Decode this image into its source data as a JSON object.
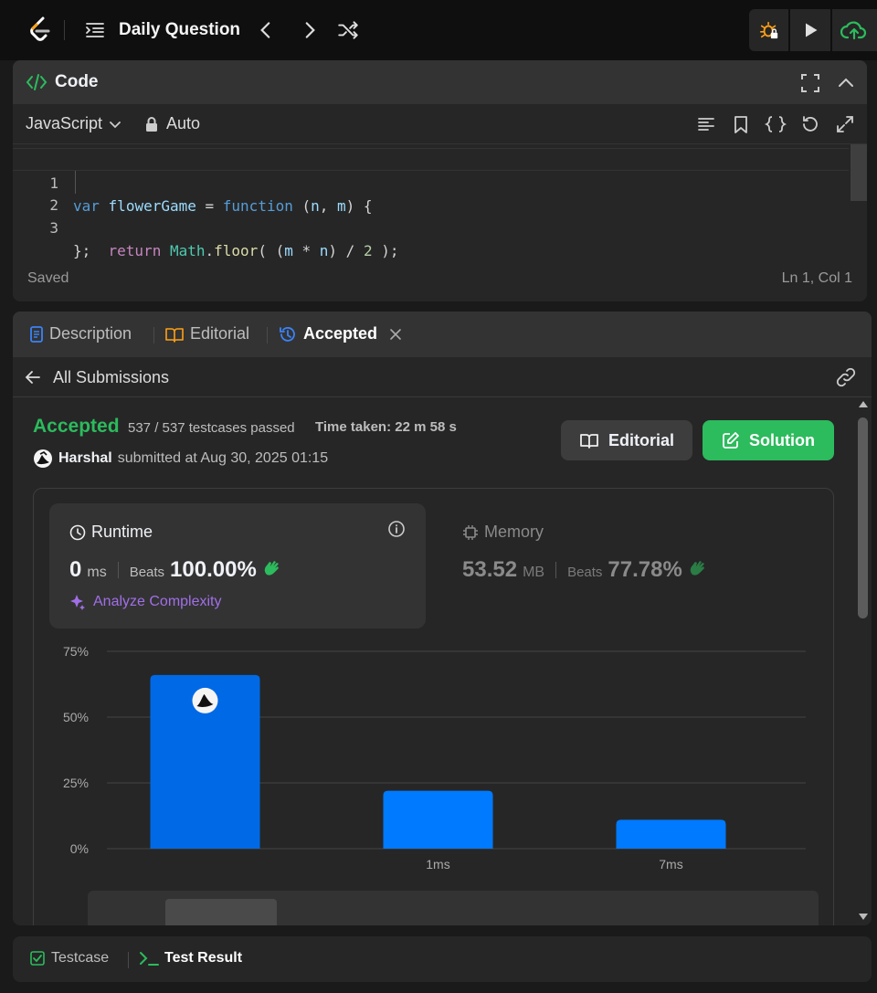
{
  "topbar": {
    "title": "Daily Question",
    "colors": {
      "logo_orange": "#ffa116",
      "debug_orange": "#ffa116",
      "upload_green": "#2cbb5d"
    },
    "icons": [
      "leetcode-logo",
      "list-icon",
      "chevron-left-icon",
      "chevron-right-icon",
      "shuffle-icon",
      "debug-icon",
      "play-icon",
      "cloud-upload-icon"
    ]
  },
  "code_panel": {
    "title": "Code",
    "language": "JavaScript",
    "mode": "Auto",
    "lines": [
      {
        "num": "1",
        "tokens": [
          [
            "kw",
            "var"
          ],
          [
            "pl",
            " "
          ],
          [
            "id",
            "flowerGame"
          ],
          [
            "pl",
            " = "
          ],
          [
            "kw",
            "function"
          ],
          [
            "pl",
            " ("
          ],
          [
            "id",
            "n"
          ],
          [
            "pl",
            ", "
          ],
          [
            "id",
            "m"
          ],
          [
            "pl",
            ") {"
          ]
        ]
      },
      {
        "num": "2",
        "tokens": [
          [
            "pl",
            "    "
          ],
          [
            "kw2",
            "return"
          ],
          [
            "pl",
            " "
          ],
          [
            "cls",
            "Math"
          ],
          [
            "pl",
            "."
          ],
          [
            "fn",
            "floor"
          ],
          [
            "pl",
            "( ("
          ],
          [
            "id",
            "m"
          ],
          [
            "pl",
            " * "
          ],
          [
            "id",
            "n"
          ],
          [
            "pl",
            ") / "
          ],
          [
            "num",
            "2"
          ],
          [
            "pl",
            " );"
          ]
        ]
      },
      {
        "num": "3",
        "tokens": [
          [
            "pl",
            "};"
          ]
        ]
      }
    ],
    "status_left": "Saved",
    "status_right": "Ln 1, Col 1"
  },
  "tabs": {
    "description": "Description",
    "editorial": "Editorial",
    "accepted": "Accepted"
  },
  "submissions": {
    "back_label": "All Submissions",
    "status": "Accepted",
    "testcases": "537 / 537 testcases passed",
    "time_taken": "Time taken: 22 m 58 s",
    "user": "Harshal",
    "submitted_at": "submitted at Aug 30, 2025 01:15",
    "editorial_btn": "Editorial",
    "solution_btn": "Solution",
    "runtime": {
      "label": "Runtime",
      "value": "0",
      "unit": "ms",
      "beats_label": "Beats",
      "beats": "100.00%",
      "analyze": "Analyze Complexity"
    },
    "memory": {
      "label": "Memory",
      "value": "53.52",
      "unit": "MB",
      "beats_label": "Beats",
      "beats": "77.78%"
    }
  },
  "chart_data": {
    "type": "bar",
    "y_ticks": [
      "75%",
      "50%",
      "25%",
      "0%"
    ],
    "ylim": [
      0,
      75
    ],
    "x_labels": [
      "",
      "1ms",
      "7ms"
    ],
    "values": [
      66,
      22,
      11
    ],
    "highlight_index": 0,
    "colors": {
      "highlight": "#0069e6",
      "normal": "#007aff"
    }
  },
  "bottom_tabs": {
    "testcase": "Testcase",
    "test_result": "Test Result"
  }
}
